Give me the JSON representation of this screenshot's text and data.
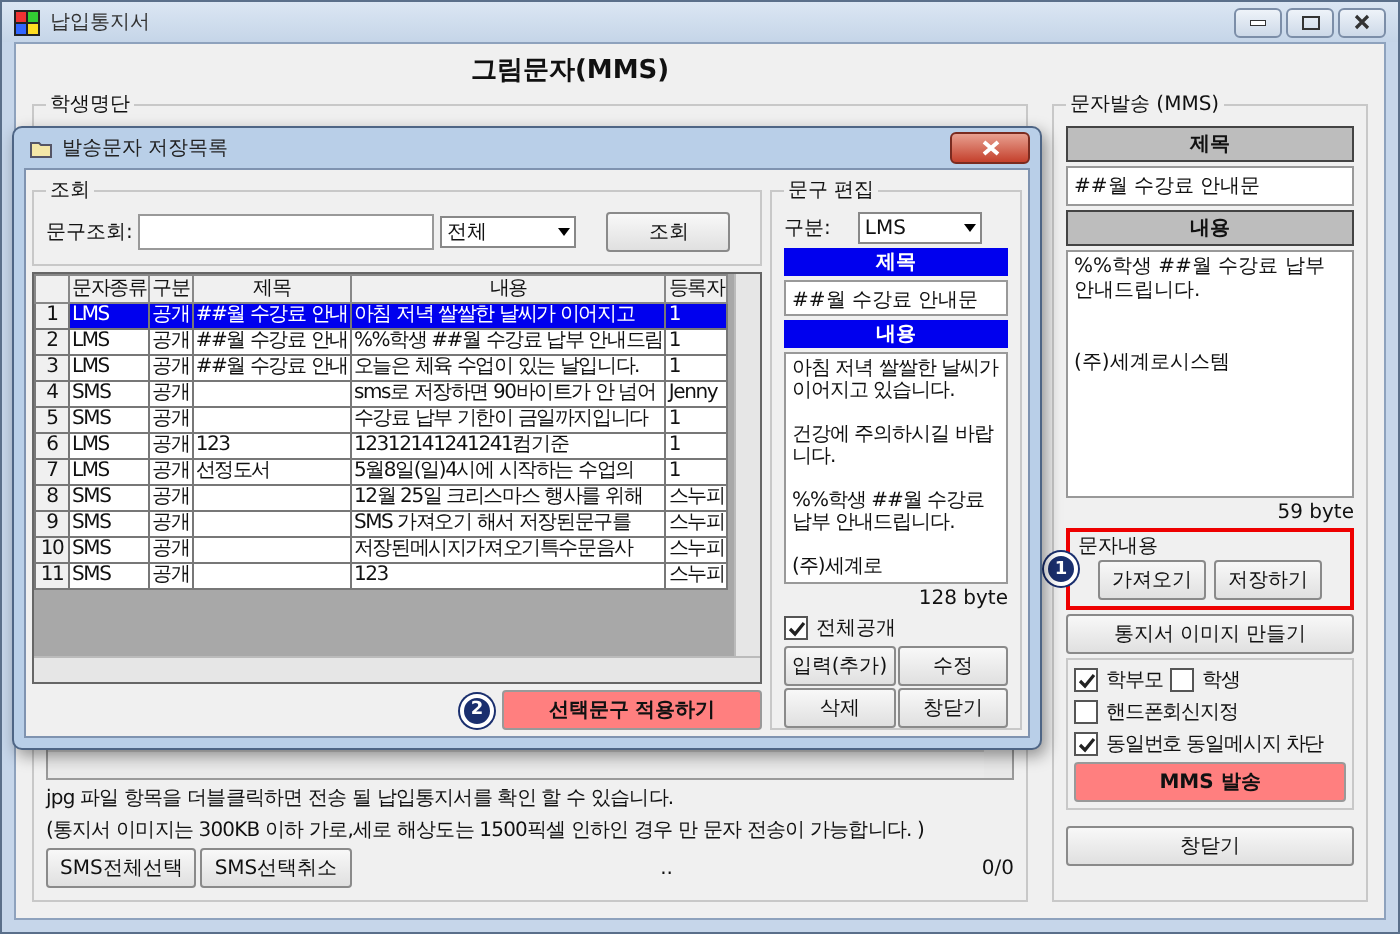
{
  "window": {
    "title": "납입통지서"
  },
  "heading": "그림문자(MMS)",
  "student_list": {
    "title": "학생명단",
    "notes": [
      "jpg 파일 항목을 더블클릭하면 전송 될 납입통지서를 확인 할 수 있습니다.",
      "(통지서 이미지는 300KB 이하 가로,세로 해상도는 1500픽셀 인하인 경우 만 문자 전송이 가능합니다. )"
    ],
    "buttons": [
      "SMS전체선택",
      "SMS선택취소"
    ],
    "status": "..",
    "count": "0/0"
  },
  "send_panel": {
    "title": "문자발송 (MMS)",
    "subject_label": "제목",
    "subject": "##월 수강료 안내문",
    "body_label": "내용",
    "body": "%%학생 ##월 수강료 납부 안내드립니다.\n\n\n(주)세계로시스템",
    "byte_count": "59 byte",
    "message_group": {
      "title": "문자내용",
      "badge": "1",
      "buttons": [
        "가져오기",
        "저장하기"
      ]
    },
    "make_image_button": "통지서 이미지 만들기",
    "option_rows": [
      [
        {
          "label": "학부모",
          "checked": true
        },
        {
          "label": "학생",
          "checked": false
        }
      ],
      [
        {
          "label": "핸드폰회신지정",
          "checked": false
        }
      ],
      [
        {
          "label": "동일번호 동일메시지 차단",
          "checked": true
        }
      ]
    ],
    "send_button": "MMS 발송",
    "close_button": "창닫기"
  },
  "dialog": {
    "title": "발송문자 저장목록",
    "search": {
      "title": "조회",
      "label": "문구조회:",
      "filter": "전체",
      "button": "조회"
    },
    "table": {
      "columns": [
        "문자종류",
        "구분",
        "제목",
        "내용",
        "등록자"
      ],
      "rows": [
        {
          "no": "1",
          "type": "LMS",
          "scope": "공개",
          "title": "##월 수강료 안내",
          "content": "아침 저녁 쌀쌀한 날씨가 이어지고",
          "author": "1",
          "selected": true
        },
        {
          "no": "2",
          "type": "LMS",
          "scope": "공개",
          "title": "##월 수강료 안내",
          "content": "%%학생 ##월 수강료 납부 안내드림",
          "author": "1",
          "selected": false
        },
        {
          "no": "3",
          "type": "LMS",
          "scope": "공개",
          "title": "##월 수강료 안내",
          "content": "오늘은 체육 수업이 있는 날입니다.",
          "author": "1",
          "selected": false
        },
        {
          "no": "4",
          "type": "SMS",
          "scope": "공개",
          "title": "",
          "content": "sms로 저장하면 90바이트가 안 넘어",
          "author": "Jenny",
          "selected": false
        },
        {
          "no": "5",
          "type": "SMS",
          "scope": "공개",
          "title": "",
          "content": "수강료 납부 기한이 금일까지입니다",
          "author": "1",
          "selected": false
        },
        {
          "no": "6",
          "type": "LMS",
          "scope": "공개",
          "title": "123",
          "content": "12312141241241컴기준",
          "author": "1",
          "selected": false
        },
        {
          "no": "7",
          "type": "LMS",
          "scope": "공개",
          "title": "선정도서",
          "content": "5월8일(일)4시에 시작하는 수업의",
          "author": "1",
          "selected": false
        },
        {
          "no": "8",
          "type": "SMS",
          "scope": "공개",
          "title": "",
          "content": "12월 25일 크리스마스 행사를 위해",
          "author": "스누피",
          "selected": false
        },
        {
          "no": "9",
          "type": "SMS",
          "scope": "공개",
          "title": "",
          "content": "SMS 가져오기 해서 저장된문구를",
          "author": "스누피",
          "selected": false
        },
        {
          "no": "10",
          "type": "SMS",
          "scope": "공개",
          "title": "",
          "content": "저장된메시지가져오기특수문음사",
          "author": "스누피",
          "selected": false
        },
        {
          "no": "11",
          "type": "SMS",
          "scope": "공개",
          "title": "",
          "content": "123",
          "author": "스누피",
          "selected": false
        }
      ]
    },
    "apply_badge": "2",
    "apply_button": "선택문구 적용하기",
    "editor": {
      "title": "문구 편집",
      "kind_label": "구분:",
      "kind": "LMS",
      "subject_label": "제목",
      "subject": "##월 수강료 안내문",
      "body_label": "내용",
      "body": "아침 저녁 쌀쌀한 날씨가 이어지고 있습니다.\n\n건강에 주의하시길 바랍니다.\n\n%%학생 ##월 수강료 납부 안내드립니다.\n\n(주)세계로",
      "byte_count": "128 byte",
      "public": {
        "label": "전체공개",
        "checked": true
      },
      "buttons": [
        "입력(추가)",
        "수정",
        "삭제",
        "창닫기"
      ]
    }
  }
}
